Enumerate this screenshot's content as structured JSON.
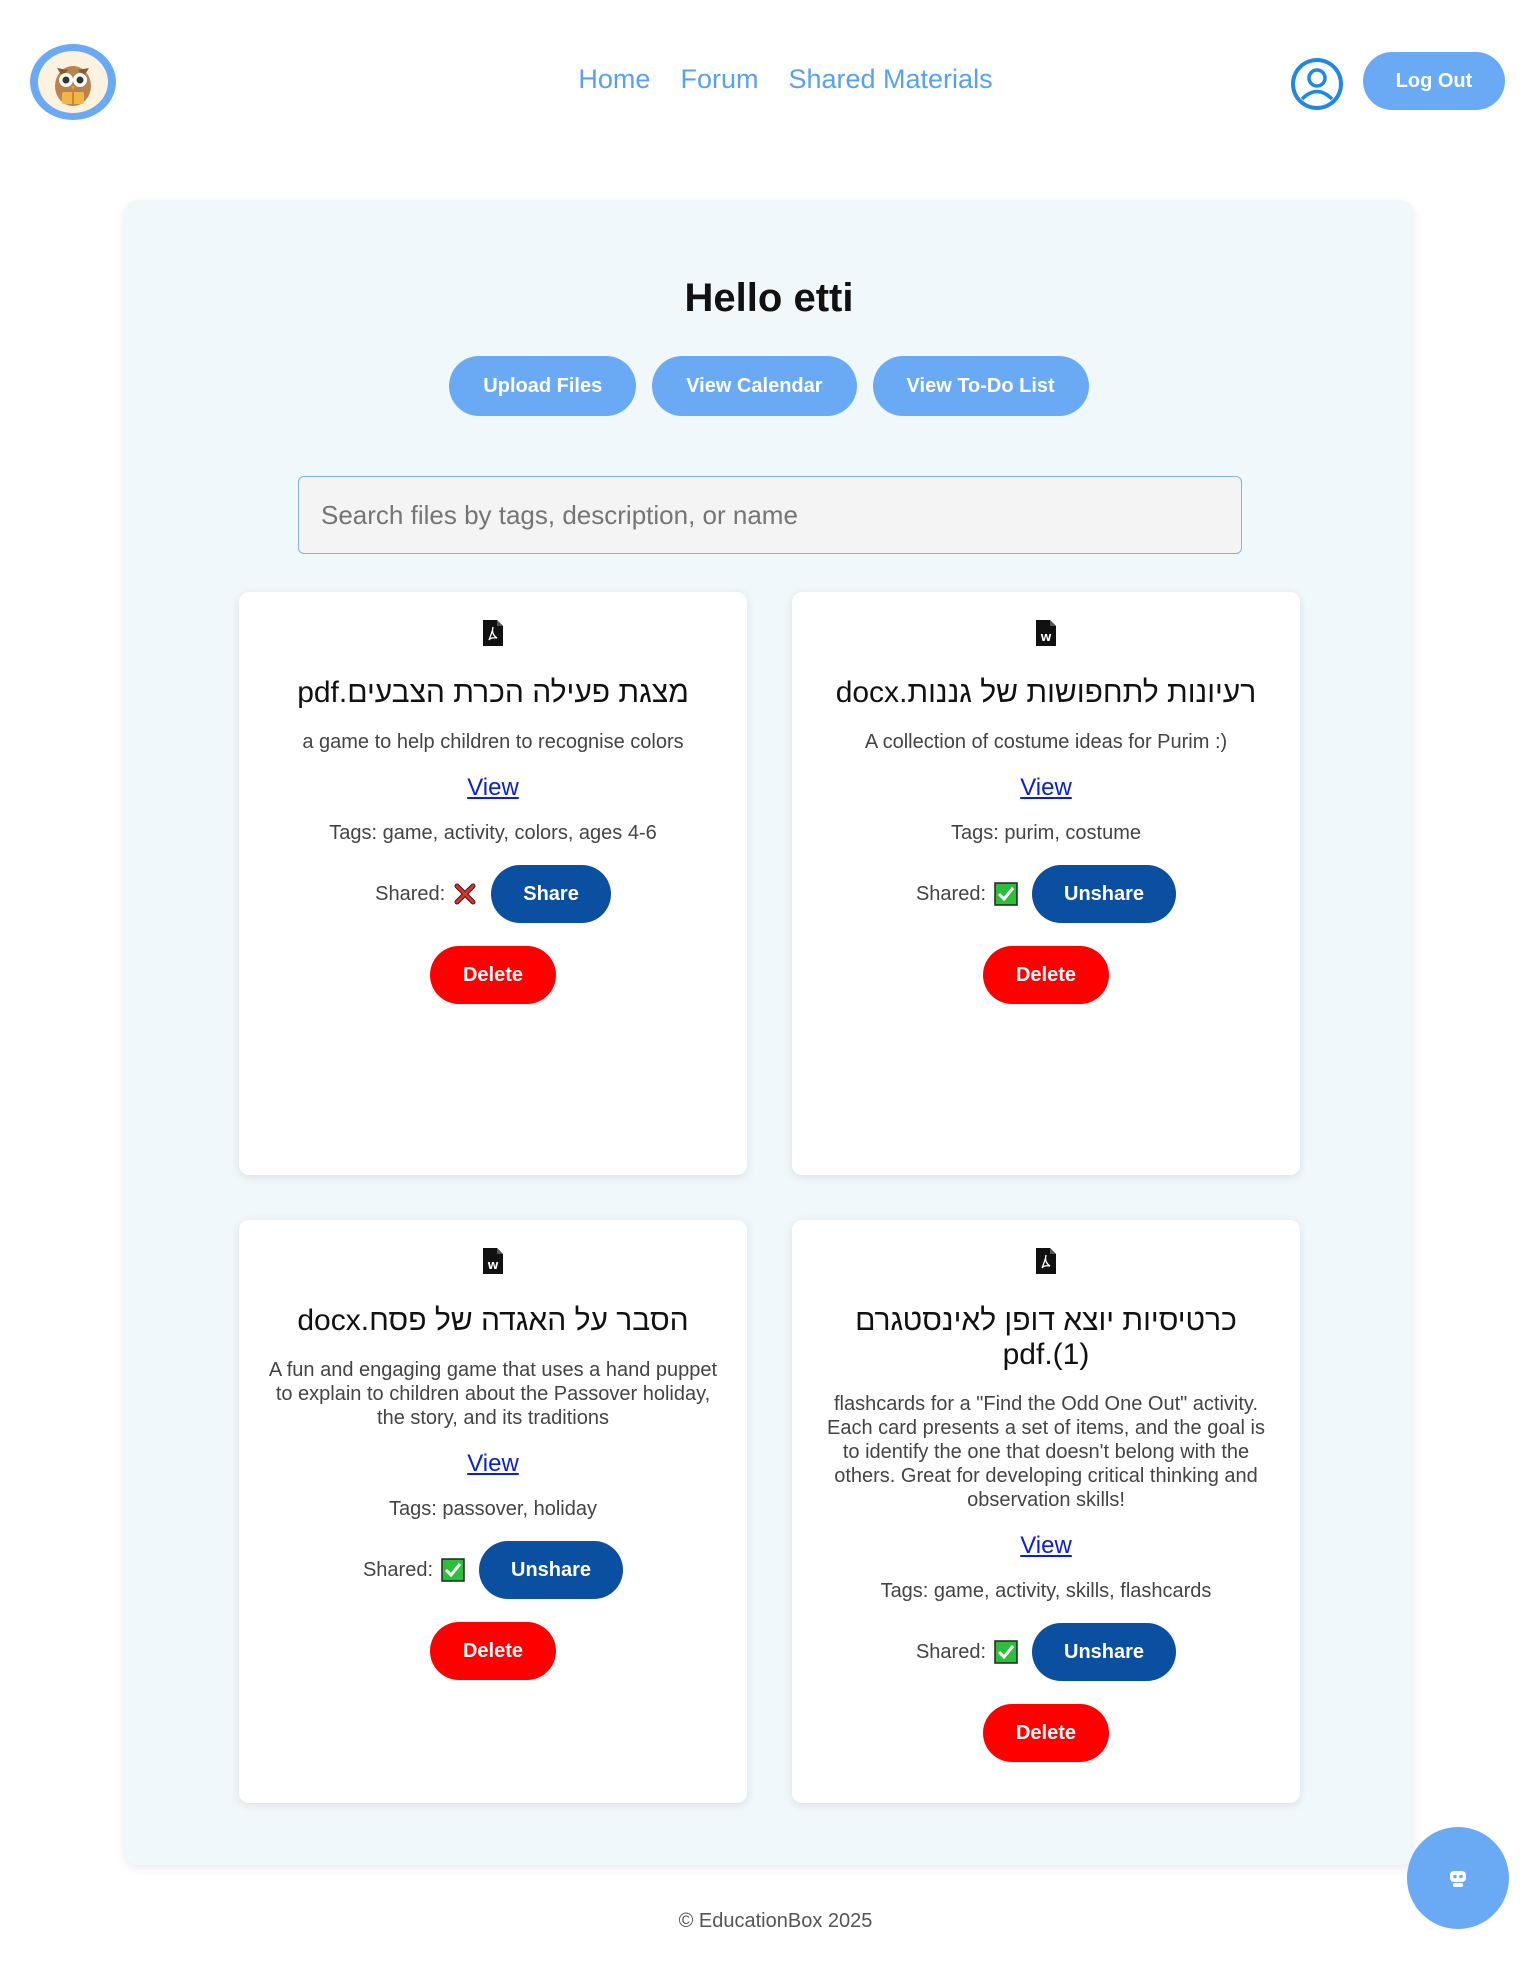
{
  "nav": {
    "home": "Home",
    "forum": "Forum",
    "shared_materials": "Shared Materials",
    "logout": "Log Out"
  },
  "main": {
    "greeting": "Hello etti",
    "actions": {
      "upload": "Upload Files",
      "calendar": "View Calendar",
      "todo": "View To-Do List"
    },
    "search_placeholder": "Search files by tags, description, or name"
  },
  "files": [
    {
      "icon": "pdf-file-icon",
      "name": "מצגת פעילה הכרת הצבעים.pdf",
      "description": "a game to help children to recognise colors",
      "view_label": "View",
      "tags": "Tags: game, activity, colors, ages 4-6",
      "shared_label": "Shared:",
      "shared": false,
      "share_button": "Share",
      "delete_button": "Delete"
    },
    {
      "icon": "word-file-icon",
      "name": "רעיונות לתחפושות של גננות.docx",
      "description": "A collection of costume ideas for Purim :)",
      "view_label": "View",
      "tags": "Tags: purim, costume",
      "shared_label": "Shared:",
      "shared": true,
      "share_button": "Unshare",
      "delete_button": "Delete"
    },
    {
      "icon": "word-file-icon",
      "name": "הסבר על האגדה של פסח.docx",
      "description": "A fun and engaging game that uses a hand puppet to explain to children about the Passover holiday, the story, and its traditions",
      "view_label": "View",
      "tags": "Tags: passover, holiday",
      "shared_label": "Shared:",
      "shared": true,
      "share_button": "Unshare",
      "delete_button": "Delete"
    },
    {
      "icon": "pdf-file-icon",
      "name": "כרטיסיות יוצא דופן לאינסטגרם (1).pdf",
      "description": "flashcards for a \"Find the Odd One Out\" activity. Each card presents a set of items, and the goal is to identify the one that doesn't belong with the others. Great for developing critical thinking and observation skills!",
      "view_label": "View",
      "tags": "Tags: game, activity, skills, flashcards",
      "shared_label": "Shared:",
      "shared": true,
      "share_button": "Unshare",
      "delete_button": "Delete"
    }
  ],
  "footer": "© EducationBox 2025",
  "colors": {
    "accent": "#6aaaf5",
    "share": "#0a4fa0",
    "delete": "#ff0000",
    "panel": "#f1f8fc"
  }
}
